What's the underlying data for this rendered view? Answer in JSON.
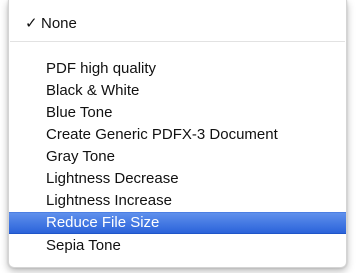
{
  "menu": {
    "items": [
      {
        "label": "None",
        "checked": true
      },
      {
        "label": "PDF high quality"
      },
      {
        "label": "Black & White"
      },
      {
        "label": "Blue Tone"
      },
      {
        "label": "Create Generic PDFX-3 Document"
      },
      {
        "label": "Gray Tone"
      },
      {
        "label": "Lightness Decrease"
      },
      {
        "label": "Lightness Increase"
      },
      {
        "label": "Reduce File Size",
        "selected": true
      },
      {
        "label": "Sepia Tone"
      }
    ],
    "check_glyph": "✓",
    "selection_color": "#3d74e0"
  }
}
